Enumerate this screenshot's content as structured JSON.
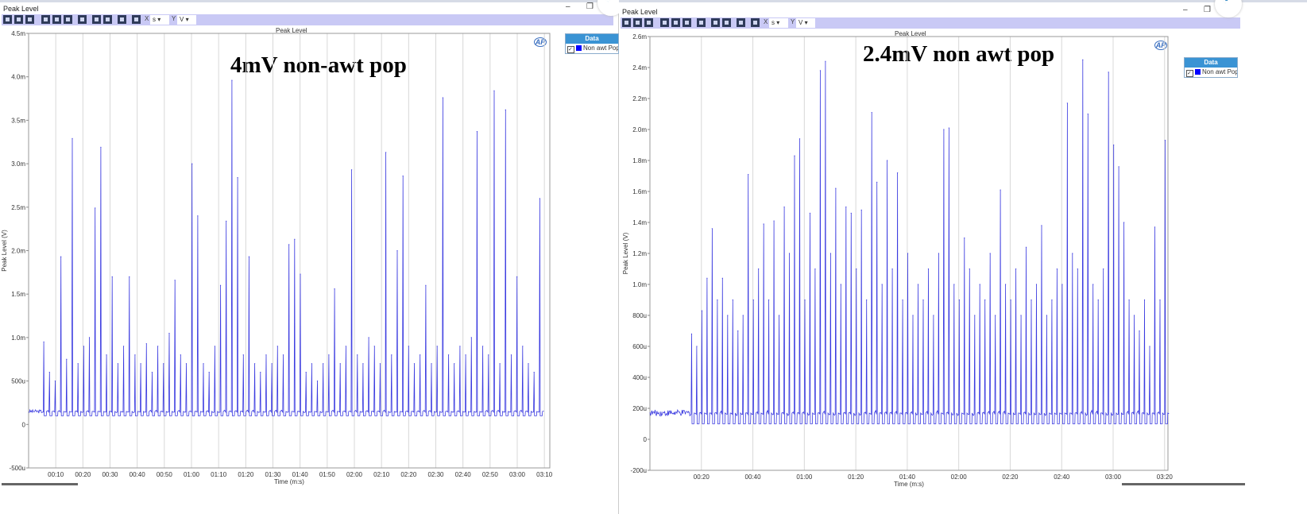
{
  "windows": [
    {
      "title": "Peak Level",
      "toolbar": {
        "x_label": "X",
        "x_unit": "s",
        "y_label": "Y",
        "y_unit": "V"
      },
      "legend": {
        "header": "Data",
        "item": "Non awt Pop",
        "checked": true,
        "color": "#0000ff"
      },
      "logo": "AP"
    },
    {
      "title": "Peak Level",
      "toolbar": {
        "x_label": "X",
        "x_unit": "s",
        "y_label": "Y",
        "y_unit": "V"
      },
      "legend": {
        "header": "Data",
        "item": "Non awt Pop",
        "checked": true,
        "color": "#0000ff"
      },
      "logo": "AP"
    }
  ],
  "window_controls": {
    "minimize": "–",
    "restore": "❐"
  },
  "chart_data": [
    {
      "type": "line",
      "title": "Peak Level",
      "annotation": "4mV non-awt pop",
      "xlabel": "Time (m:s)",
      "ylabel": "Peak Level (V)",
      "xlim": [
        0,
        192
      ],
      "ylim": [
        -0.0005,
        0.0045
      ],
      "grid": "vertical",
      "line_color": "#3a3ae0",
      "baseline": 0.00015,
      "floor": 0.0001,
      "xticks": [
        {
          "v": 10,
          "l": "00:10"
        },
        {
          "v": 20,
          "l": "00:20"
        },
        {
          "v": 30,
          "l": "00:30"
        },
        {
          "v": 40,
          "l": "00:40"
        },
        {
          "v": 50,
          "l": "00:50"
        },
        {
          "v": 60,
          "l": "01:00"
        },
        {
          "v": 70,
          "l": "01:10"
        },
        {
          "v": 80,
          "l": "01:20"
        },
        {
          "v": 90,
          "l": "01:30"
        },
        {
          "v": 100,
          "l": "01:40"
        },
        {
          "v": 110,
          "l": "01:50"
        },
        {
          "v": 120,
          "l": "02:00"
        },
        {
          "v": 130,
          "l": "02:10"
        },
        {
          "v": 140,
          "l": "02:20"
        },
        {
          "v": 150,
          "l": "02:30"
        },
        {
          "v": 160,
          "l": "02:40"
        },
        {
          "v": 170,
          "l": "02:50"
        },
        {
          "v": 180,
          "l": "03:00"
        },
        {
          "v": 190,
          "l": "03:10"
        }
      ],
      "yticks": [
        {
          "v": 0.0045,
          "l": "4.5m"
        },
        {
          "v": 0.004,
          "l": "4.0m"
        },
        {
          "v": 0.0035,
          "l": "3.5m"
        },
        {
          "v": 0.003,
          "l": "3.0m"
        },
        {
          "v": 0.0025,
          "l": "2.5m"
        },
        {
          "v": 0.002,
          "l": "2.0m"
        },
        {
          "v": 0.0015,
          "l": "1.5m"
        },
        {
          "v": 0.001,
          "l": "1.0m"
        },
        {
          "v": 0.0005,
          "l": "500u"
        },
        {
          "v": 0,
          "l": "0"
        },
        {
          "v": -0.0005,
          "l": "-500u"
        }
      ],
      "x": [
        5.6,
        7.7,
        9.8,
        11.9,
        14,
        16.1,
        18.2,
        20.3,
        22.4,
        24.5,
        26.6,
        28.7,
        30.8,
        32.9,
        35,
        37.1,
        39.2,
        41.3,
        43.4,
        45.5,
        47.6,
        49.7,
        51.8,
        53.9,
        56,
        58.1,
        60.2,
        62.3,
        64.4,
        66.5,
        68.6,
        70.7,
        72.8,
        74.9,
        77,
        79.1,
        81.2,
        83.3,
        85.4,
        87.5,
        89.6,
        91.7,
        93.8,
        95.9,
        98,
        100.1,
        102.2,
        104.3,
        106.4,
        108.5,
        110.6,
        112.7,
        114.8,
        116.9,
        119,
        121.1,
        123.2,
        125.3,
        127.4,
        129.5,
        131.6,
        133.7,
        135.8,
        137.9,
        140,
        142.1,
        144.2,
        146.3,
        148.4,
        150.5,
        152.6,
        154.7,
        156.8,
        158.9,
        161,
        163.1,
        165.2,
        167.3,
        169.4,
        171.5,
        173.6,
        175.7,
        177.8,
        179.9,
        182,
        184.1,
        186.2,
        188.3
      ],
      "y": [
        0.00095,
        0.0006,
        0.0005,
        0.00193,
        0.00075,
        0.00329,
        0.0007,
        0.0009,
        0.001,
        0.00249,
        0.00319,
        0.0008,
        0.0017,
        0.0007,
        0.0009,
        0.0017,
        0.0008,
        0.0007,
        0.00093,
        0.0006,
        0.0009,
        0.0007,
        0.00105,
        0.00166,
        0.0008,
        0.0007,
        0.003,
        0.0024,
        0.0007,
        0.0006,
        0.0009,
        0.0016,
        0.00234,
        0.00396,
        0.00284,
        0.0008,
        0.00193,
        0.0007,
        0.0006,
        0.0008,
        0.0007,
        0.0009,
        0.0008,
        0.00207,
        0.00213,
        0.00173,
        0.0006,
        0.0007,
        0.0005,
        0.0007,
        0.0008,
        0.00156,
        0.0007,
        0.0009,
        0.00293,
        0.0008,
        0.0007,
        0.001,
        0.0009,
        0.0007,
        0.00313,
        0.0008,
        0.002,
        0.00286,
        0.0009,
        0.0007,
        0.0008,
        0.0016,
        0.0007,
        0.0009,
        0.00376,
        0.0008,
        0.0007,
        0.0009,
        0.0008,
        0.001,
        0.00337,
        0.0009,
        0.0008,
        0.00384,
        0.0007,
        0.00362,
        0.0008,
        0.0017,
        0.0009,
        0.0007,
        0.0006,
        0.0026
      ]
    },
    {
      "type": "line",
      "title": "Peak Level",
      "annotation": "2.4mV non awt pop",
      "xlabel": "Time (m:s)",
      "ylabel": "Peak Level (V)",
      "xlim": [
        0,
        201.3
      ],
      "ylim": [
        -0.0002,
        0.0026
      ],
      "grid": "vertical",
      "line_color": "#3a3ae0",
      "baseline": 0.00017,
      "floor": 0.0001,
      "xticks": [
        {
          "v": 20,
          "l": "00:20"
        },
        {
          "v": 40,
          "l": "00:40"
        },
        {
          "v": 60,
          "l": "01:00"
        },
        {
          "v": 80,
          "l": "01:20"
        },
        {
          "v": 100,
          "l": "01:40"
        },
        {
          "v": 120,
          "l": "02:00"
        },
        {
          "v": 140,
          "l": "02:20"
        },
        {
          "v": 160,
          "l": "02:40"
        },
        {
          "v": 180,
          "l": "03:00"
        },
        {
          "v": 200,
          "l": "03:20"
        }
      ],
      "yticks": [
        {
          "v": 0.0026,
          "l": "2.6m"
        },
        {
          "v": 0.0024,
          "l": "2.4m"
        },
        {
          "v": 0.0022,
          "l": "2.2m"
        },
        {
          "v": 0.002,
          "l": "2.0m"
        },
        {
          "v": 0.0018,
          "l": "1.8m"
        },
        {
          "v": 0.0016,
          "l": "1.6m"
        },
        {
          "v": 0.0014,
          "l": "1.4m"
        },
        {
          "v": 0.0012,
          "l": "1.2m"
        },
        {
          "v": 0.001,
          "l": "1.0m"
        },
        {
          "v": 0.0008,
          "l": "800u"
        },
        {
          "v": 0.0006,
          "l": "600u"
        },
        {
          "v": 0.0004,
          "l": "400u"
        },
        {
          "v": 0.0002,
          "l": "200u"
        },
        {
          "v": 0,
          "l": "0"
        },
        {
          "v": -0.0002,
          "l": "-200u"
        }
      ],
      "x": [
        16.2,
        18.2,
        20.2,
        22.2,
        24.2,
        26.2,
        28.2,
        30.2,
        32.2,
        34.2,
        36.2,
        38.2,
        40.2,
        42.2,
        44.2,
        46.2,
        48.2,
        50.2,
        52.2,
        54.2,
        56.2,
        58.2,
        60.2,
        62.2,
        64.2,
        66.2,
        68.2,
        70.2,
        72.2,
        74.2,
        76.2,
        78.2,
        80.2,
        82.2,
        84.2,
        86.2,
        88.2,
        90.2,
        92.2,
        94.2,
        96.2,
        98.2,
        100.2,
        102.2,
        104.2,
        106.2,
        108.2,
        110.2,
        112.2,
        114.2,
        116.2,
        118.2,
        120.2,
        122.2,
        124.2,
        126.2,
        128.2,
        130.2,
        132.2,
        134.2,
        136.2,
        138.2,
        140.2,
        142.2,
        144.2,
        146.2,
        148.2,
        150.2,
        152.2,
        154.2,
        156.2,
        158.2,
        160.2,
        162.2,
        164.2,
        166.2,
        168.2,
        170.2,
        172.2,
        174.2,
        176.2,
        178.2,
        180.2,
        182.2,
        184.2,
        186.2,
        188.2,
        190.2,
        192.2,
        194.2,
        196.2,
        198.2,
        200.2
      ],
      "y": [
        0.00068,
        0.0006,
        0.00083,
        0.00104,
        0.00136,
        0.0009,
        0.00104,
        0.0008,
        0.0009,
        0.0007,
        0.0008,
        0.00171,
        0.0009,
        0.0011,
        0.00139,
        0.0009,
        0.00141,
        0.0008,
        0.0015,
        0.0012,
        0.00183,
        0.00194,
        0.0009,
        0.00146,
        0.0011,
        0.00238,
        0.00244,
        0.0012,
        0.00162,
        0.001,
        0.0015,
        0.00146,
        0.0011,
        0.00148,
        0.0009,
        0.00211,
        0.00166,
        0.001,
        0.0018,
        0.0011,
        0.00172,
        0.0009,
        0.0012,
        0.0008,
        0.001,
        0.0009,
        0.0011,
        0.0008,
        0.0012,
        0.002,
        0.00201,
        0.001,
        0.0009,
        0.0013,
        0.0011,
        0.0008,
        0.001,
        0.0009,
        0.0012,
        0.0008,
        0.00161,
        0.001,
        0.0009,
        0.0011,
        0.0008,
        0.00124,
        0.0009,
        0.001,
        0.00138,
        0.0008,
        0.0009,
        0.0011,
        0.001,
        0.00217,
        0.0012,
        0.0011,
        0.00245,
        0.0021,
        0.001,
        0.0009,
        0.0011,
        0.00237,
        0.0019,
        0.00176,
        0.0014,
        0.0009,
        0.0008,
        0.0007,
        0.0009,
        0.0006,
        0.00137,
        0.0009,
        0.00193
      ]
    }
  ]
}
